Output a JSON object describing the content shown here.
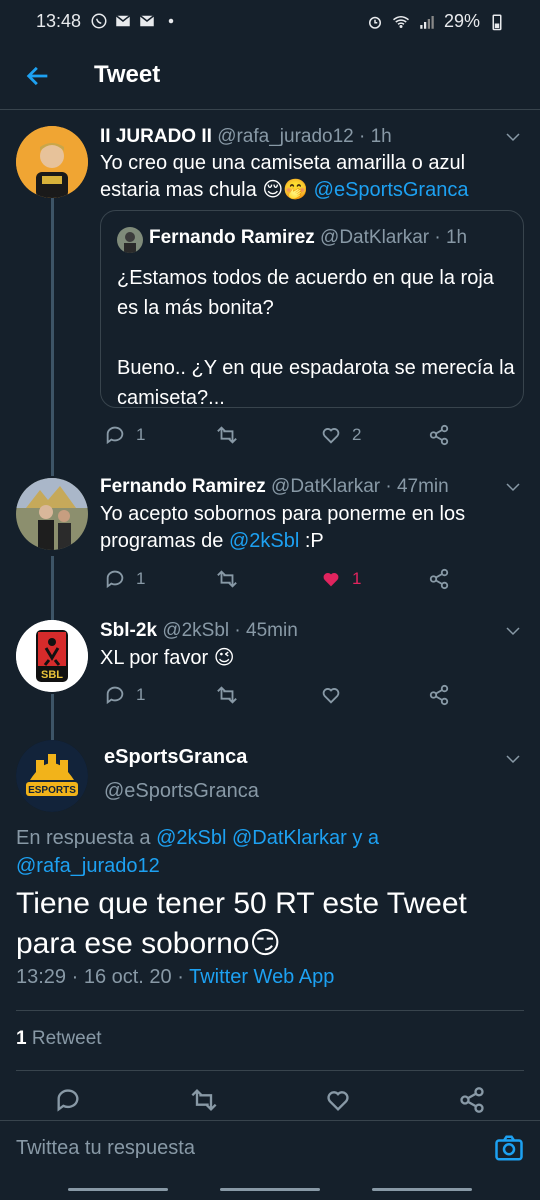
{
  "status_bar": {
    "time": "13:48",
    "battery": "29%"
  },
  "header": {
    "title": "Tweet"
  },
  "reply1": {
    "name": "II JURADO II",
    "meta": "@rafa_jurado12 · 1h",
    "text": "Yo creo que una camiseta amarilla o azul estaria mas chula",
    "mention": "@eSportsGranca",
    "emoji": "😌🤭",
    "quote": {
      "name": "Fernando Ramirez",
      "meta": "@DatKlarkar · 1h",
      "line1": "¿Estamos todos de acuerdo en que la roja es la más bonita?",
      "line2": "Bueno.. ¿Y en que espadarota se merecía la camiseta?..."
    },
    "reply_count": "1",
    "like_count": "2"
  },
  "reply2": {
    "name": "Fernando Ramirez",
    "meta": "@DatKlarkar · 47min",
    "text_before": "Yo acepto sobornos para ponerme en los programas de ",
    "mention": "@2kSbl",
    "text_after": " :P",
    "reply_count": "1",
    "like_count": "1"
  },
  "reply3": {
    "name": "Sbl-2k",
    "meta": "@2kSbl · 45min",
    "text": "XL por favor 😉",
    "reply_count": "1",
    "avatar_text": "SBL"
  },
  "main_tweet": {
    "name": "eSportsGranca",
    "handle": "@eSportsGranca",
    "reply_prefix": "En respuesta a",
    "reply_mentions": "@2kSbl @DatKlarkar",
    "reply_and": "y a",
    "reply_last": "@rafa_jurado12",
    "text": "Tiene que tener 50 RT este Tweet para ese soborno😏",
    "time_date": "13:29 · 16 oct. 20 ·",
    "source": "Twitter Web App",
    "retweet_count": "1",
    "retweet_label": "Retweet",
    "avatar_text": "ESPORTS"
  },
  "reply_bar": {
    "placeholder": "Twittea tu respuesta"
  },
  "colors": {
    "background": "#15202b",
    "accent": "#1da1f2",
    "muted": "#8899a6",
    "like": "#e0245e",
    "border": "#38444d"
  }
}
